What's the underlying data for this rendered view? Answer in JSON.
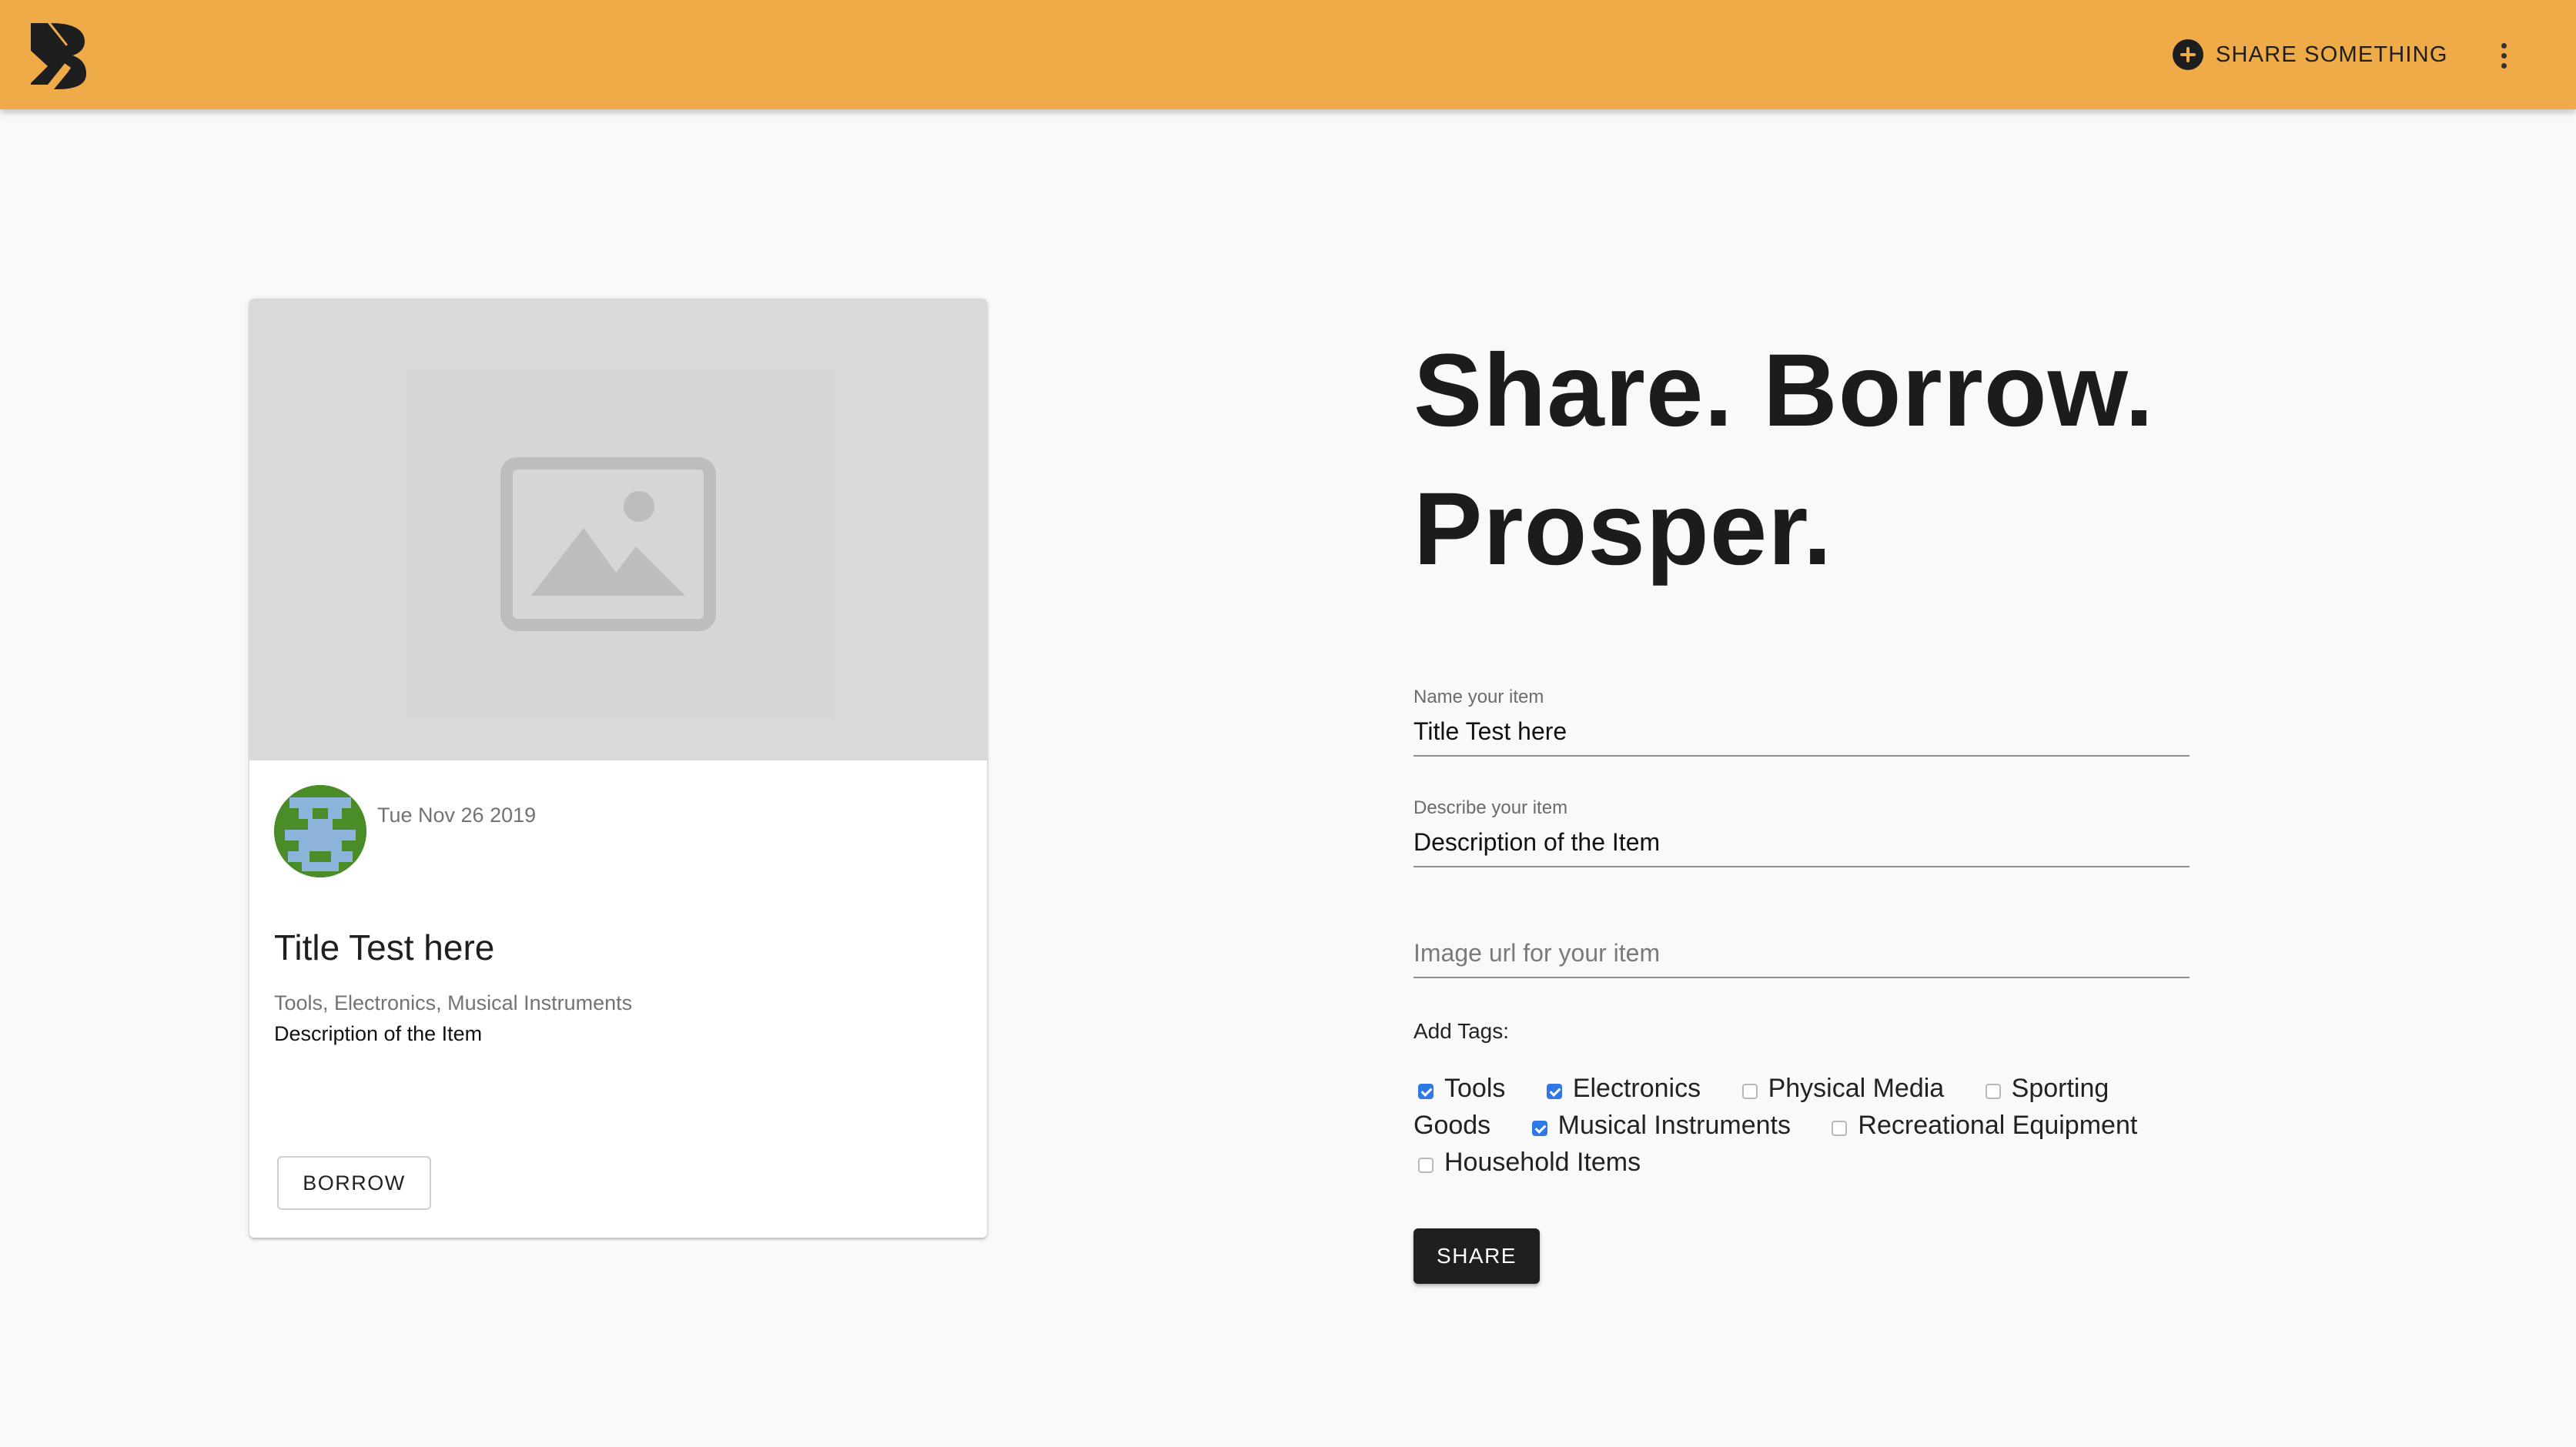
{
  "header": {
    "share_label": "SHARE SOMETHING",
    "brand_color": "#eeab47"
  },
  "card": {
    "image_icon": "image-placeholder-icon",
    "date": "Tue Nov 26 2019",
    "title": "Title Test here",
    "tags": "Tools, Electronics, Musical Instruments",
    "description": "Description of the Item",
    "borrow_label": "BORROW"
  },
  "form": {
    "headline_line1": "Share. Borrow.",
    "headline_line2": "Prosper.",
    "name_label": "Name your item",
    "name_value": "Title Test here",
    "describe_label": "Describe your item",
    "describe_value": "Description of the Item",
    "image_placeholder": "Image url for your item",
    "tags_label": "Add Tags:",
    "tags": [
      {
        "label": "Tools",
        "checked": true
      },
      {
        "label": "Electronics",
        "checked": true
      },
      {
        "label": "Physical Media",
        "checked": false
      },
      {
        "label": "Sporting Goods",
        "checked": false
      },
      {
        "label": "Musical Instruments",
        "checked": true
      },
      {
        "label": "Recreational Equipment",
        "checked": false
      },
      {
        "label": "Household Items",
        "checked": false
      }
    ],
    "share_label": "SHARE",
    "checkbox_color": "#2f79e6"
  }
}
